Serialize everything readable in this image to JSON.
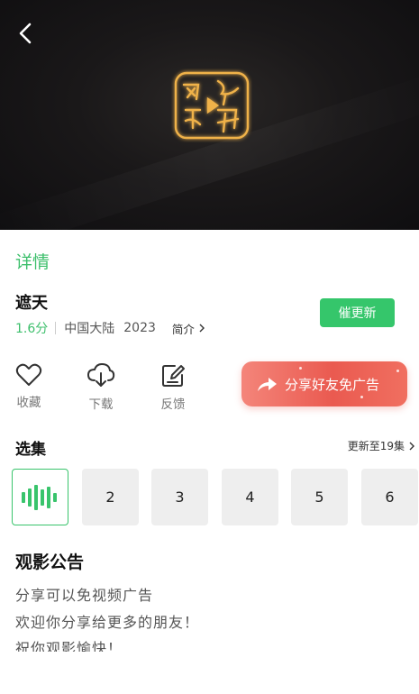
{
  "video": {
    "logo_text": "网络视听"
  },
  "details": {
    "tab_label": "详情",
    "title": "遮天",
    "score": "1.6分",
    "region": "中国大陆",
    "year": "2023",
    "intro_label": "简介",
    "urge_button": "催更新"
  },
  "actions": {
    "favorite": "收藏",
    "download": "下载",
    "feedback": "反馈",
    "share_ad_free": "分享好友免广告"
  },
  "episodes": {
    "title": "选集",
    "update_status": "更新至19集",
    "items": [
      {
        "label": "",
        "state": "playing"
      },
      {
        "label": "2"
      },
      {
        "label": "3"
      },
      {
        "label": "4"
      },
      {
        "label": "5"
      },
      {
        "label": "6"
      }
    ]
  },
  "notice": {
    "title": "观影公告",
    "lines": [
      "分享可以免视频广告",
      "欢迎你分享给更多的朋友！",
      "祝你观影愉快！"
    ]
  },
  "colors": {
    "accent_green": "#35c66b",
    "share_red": "#ea5a50",
    "logo_gold": "#f0b24a"
  },
  "icons": [
    "back-arrow-icon",
    "heart-icon",
    "cloud-download-icon",
    "edit-square-icon",
    "share-arrow-icon",
    "sound-wave-icon",
    "chevron-right-icon"
  ]
}
